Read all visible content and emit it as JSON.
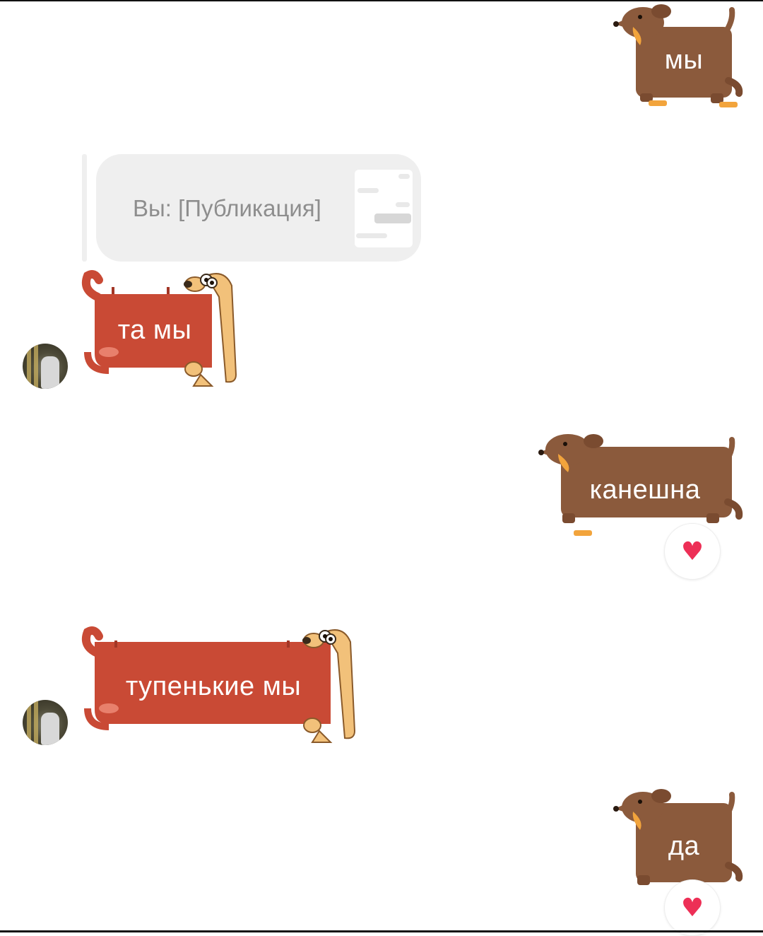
{
  "messages": [
    {
      "id": "m1",
      "side": "out",
      "sticker": "brown-dachshund",
      "text": "мы"
    },
    {
      "id": "m2",
      "side": "out",
      "type": "reply-quote",
      "text": "Вы: [Публикация]"
    },
    {
      "id": "m3",
      "side": "in",
      "sticker": "red-dachshund",
      "text": "та мы"
    },
    {
      "id": "m4",
      "side": "out",
      "sticker": "brown-dachshund",
      "text": "канешна",
      "reaction": "♥"
    },
    {
      "id": "m5",
      "side": "in",
      "sticker": "red-dachshund",
      "text": "тупенькие мы"
    },
    {
      "id": "m6",
      "side": "out",
      "sticker": "brown-dachshund",
      "text": "да",
      "reaction": "♥"
    }
  ],
  "colors": {
    "brown_body": "#8b5a3c",
    "red_body": "#c94a35",
    "cream_dog": "#f2c17a",
    "reply_bubble": "#efefef",
    "reply_text": "#8e8e8e",
    "heart": "#ed2f56"
  }
}
